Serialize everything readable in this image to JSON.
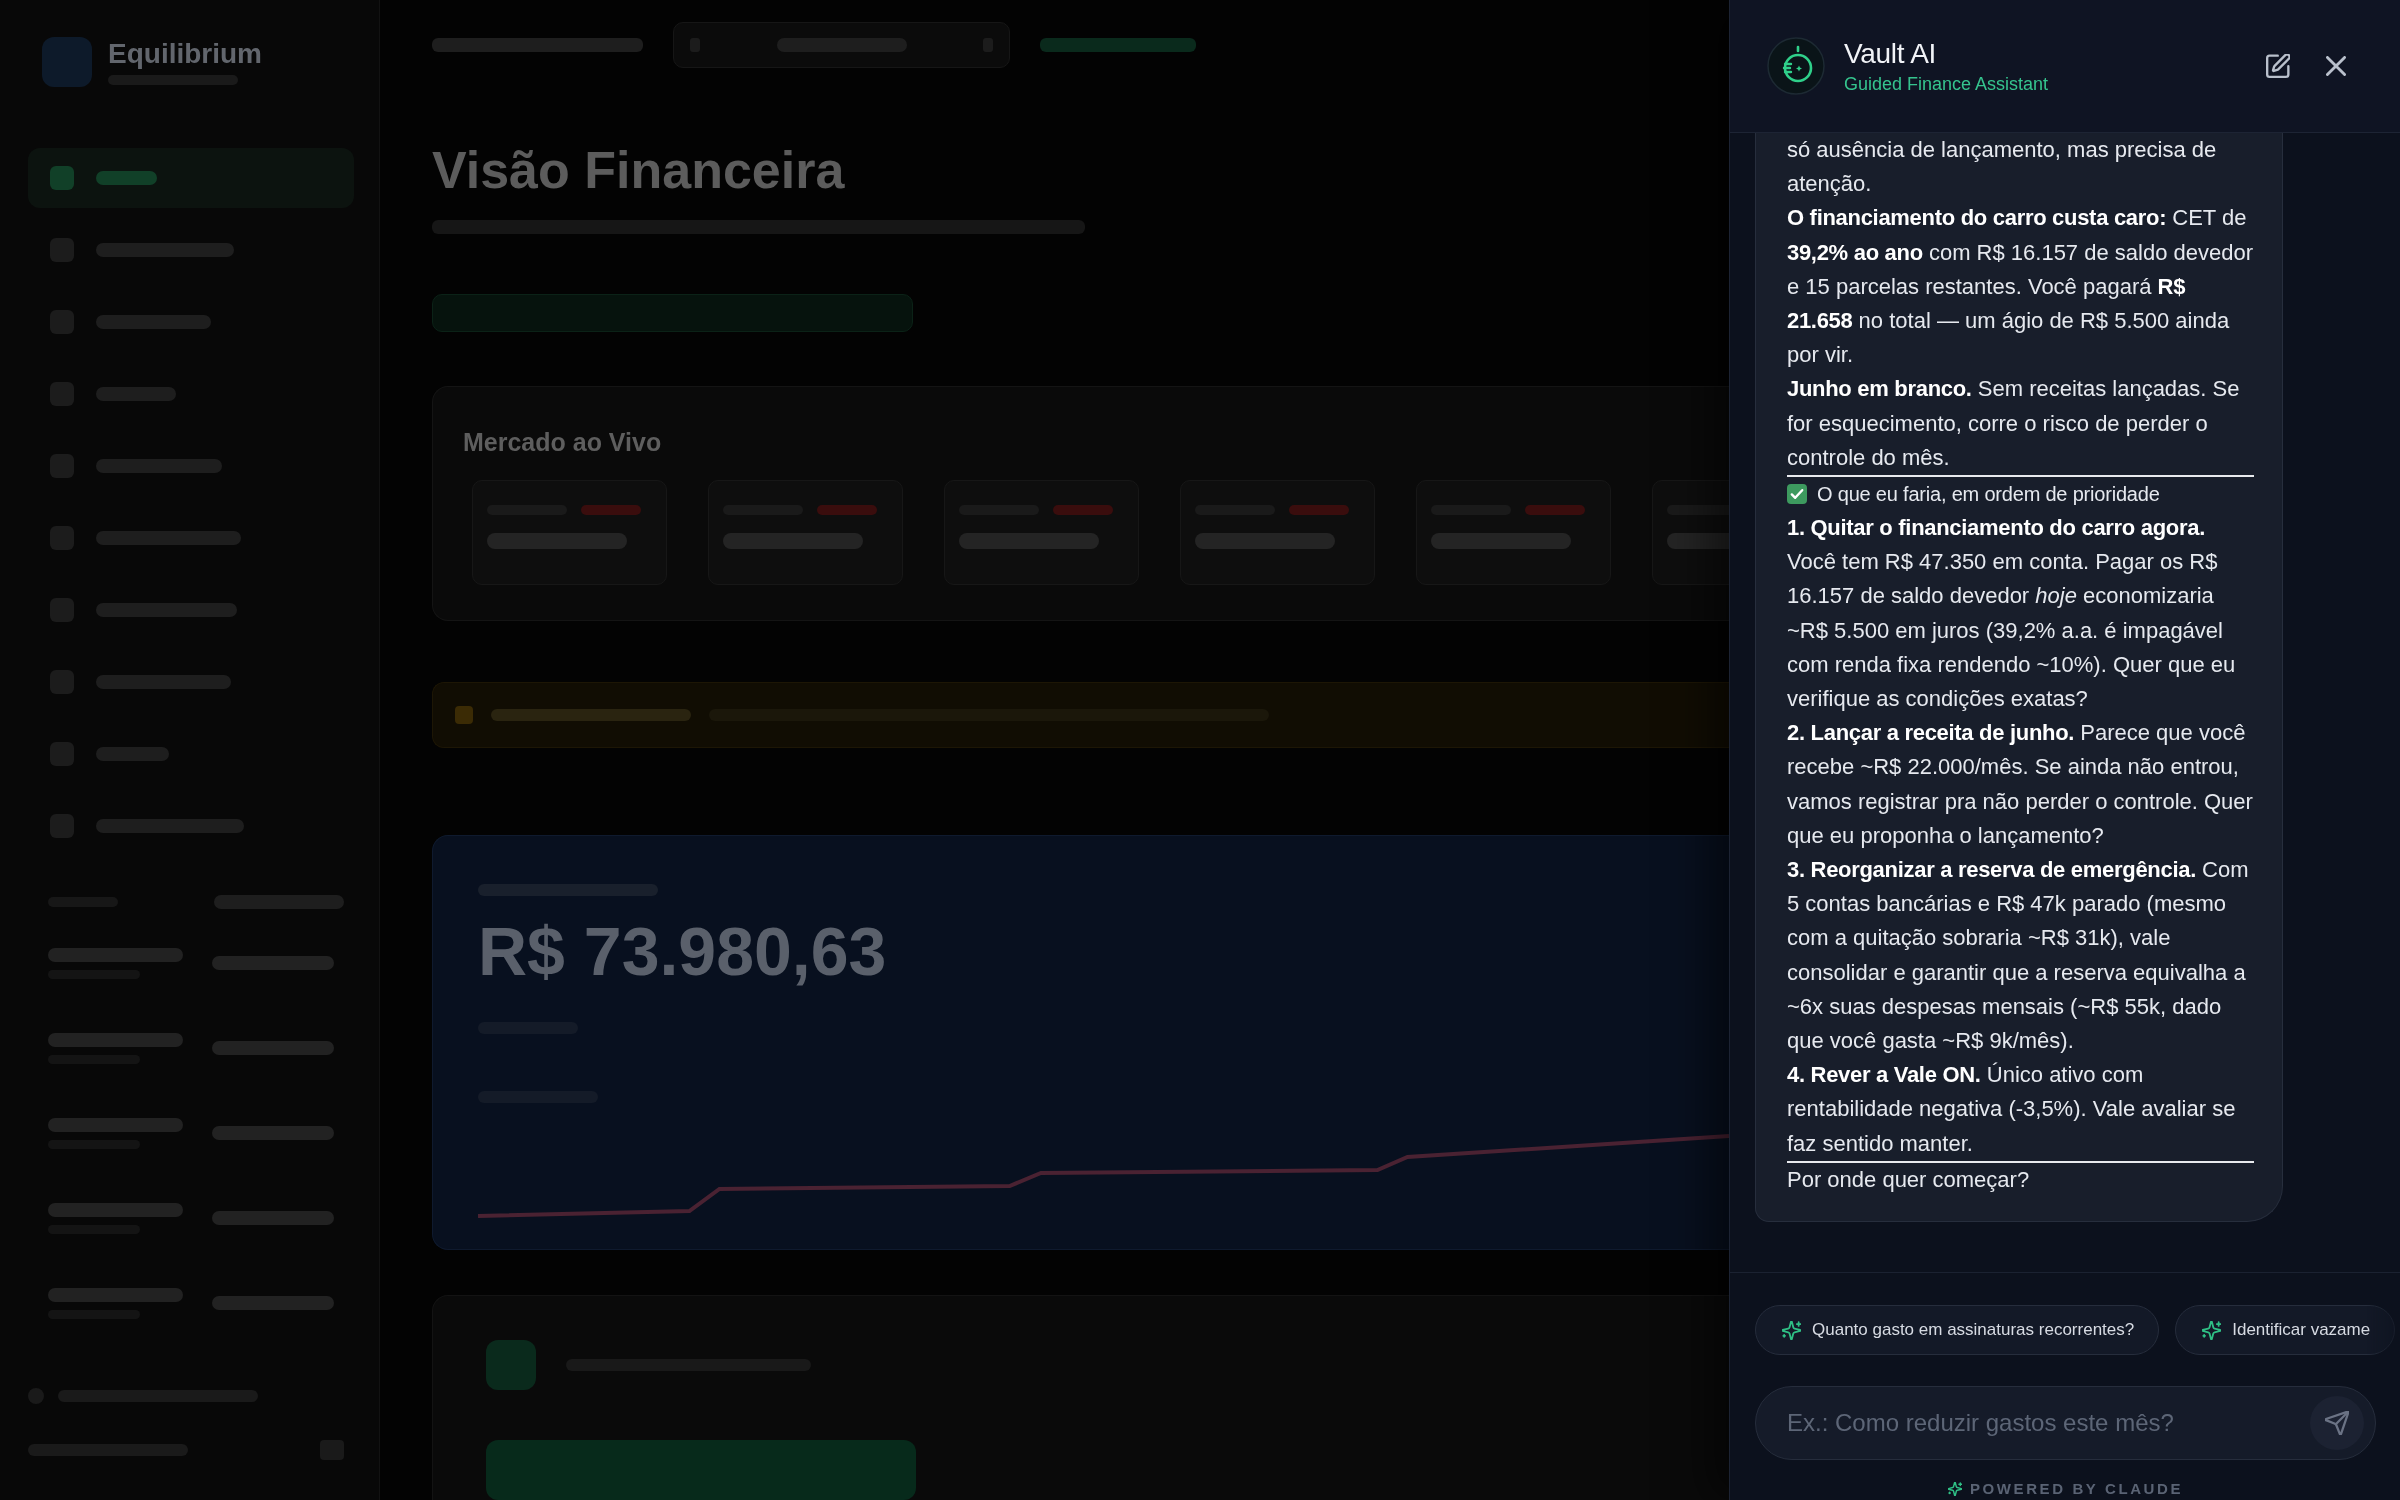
{
  "backdrop": {
    "brand": "Equilibrium",
    "sidebar_items": [
      {
        "selected": true
      },
      {
        "selected": false
      },
      {
        "selected": false
      },
      {
        "selected": false
      },
      {
        "selected": false
      },
      {
        "selected": false
      },
      {
        "selected": false
      },
      {
        "selected": false
      },
      {
        "selected": false
      },
      {
        "selected": false
      }
    ],
    "page_title": "Visão Financeira",
    "market_card": {
      "title": "Mercado ao Vivo"
    },
    "balance_card": {
      "amount": "R$ 73.980,63"
    }
  },
  "assistant_panel": {
    "title": "Vault AI",
    "subtitle": "Guided Finance Assistant",
    "messages": [
      {
        "blocks": [
          {
            "kind": "paragraph",
            "text": "só ausência de lançamento, mas precisa de atenção."
          },
          {
            "kind": "paragraph",
            "text": "**O financiamento do carro custa caro:** CET de **39,2% ao ano** com R$ 16.157 de saldo devedor e 15 parcelas restantes. Você pagará **R$ 21.658** no total — um ágio de R$ 5.500 ainda por vir."
          },
          {
            "kind": "paragraph",
            "text": "**Junho em branco.** Sem receitas lançadas. Se for esquecimento, corre o risco de perder o controle do mês."
          },
          {
            "kind": "rule"
          },
          {
            "kind": "heading",
            "text": "O que eu faria, em ordem de prioridade"
          },
          {
            "kind": "paragraph",
            "text": "**1. Quitar o financiamento do carro agora.** Você tem R$ 47.350 em conta. Pagar os R$ 16.157 de saldo devedor *hoje* economizaria ~R$ 5.500 em juros (39,2% a.a. é impagável com renda fixa rendendo ~10%). Quer que eu verifique as condições exatas?"
          },
          {
            "kind": "paragraph",
            "text": "**2. Lançar a receita de junho.** Parece que você recebe ~R$ 22.000/mês. Se ainda não entrou, vamos registrar pra não perder o controle. Quer que eu proponha o lançamento?"
          },
          {
            "kind": "paragraph",
            "text": "**3. Reorganizar a reserva de emergência.** Com 5 contas bancárias e R$ 47k parado (mesmo com a quitação sobraria ~R$ 31k), vale consolidar e garantir que a reserva equivalha a ~6x suas despesas mensais (~R$ 55k, dado que você gasta ~R$ 9k/mês)."
          },
          {
            "kind": "paragraph",
            "text": "**4. Rever a Vale ON.** Único ativo com rentabilidade negativa (-3,5%). Vale avaliar se faz sentido manter."
          },
          {
            "kind": "rule"
          },
          {
            "kind": "paragraph",
            "text": "Por onde quer começar?"
          }
        ]
      }
    ],
    "suggestions": [
      "Quanto gasto em assinaturas recorrentes?",
      "Identificar vazame"
    ],
    "input": {
      "placeholder": "Ex.: Como reduzir gastos este mês?"
    },
    "footer": "POWERED BY CLAUDE"
  }
}
